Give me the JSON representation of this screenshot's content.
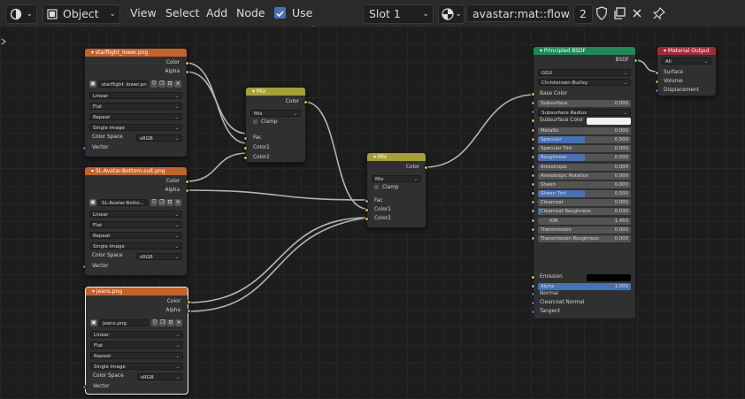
{
  "header": {
    "editor_icon": "node-editor-icon",
    "object_mode": "Object",
    "menus": [
      "View",
      "Select",
      "Add",
      "Node"
    ],
    "use_nodes_label": "Use Nodes",
    "use_nodes_checked": true,
    "slot": "Slot 1",
    "material_name": "avastar:mat::flower..",
    "user_count": "2"
  },
  "nodes": {
    "tex1": {
      "title": "starflight_lower.png",
      "out_color": "Color",
      "out_alpha": "Alpha",
      "image": "starflight_lower.png",
      "interpolation": "Linear",
      "projection": "Flat",
      "extension": "Repeat",
      "source": "Single Image",
      "colorspace_label": "Color Space",
      "colorspace": "sRGB",
      "vector": "Vector"
    },
    "tex2": {
      "title": "SL-Avatar-Bottom-suit.png",
      "out_color": "Color",
      "out_alpha": "Alpha",
      "image": "SL-Avatar-Botto...",
      "interpolation": "Linear",
      "projection": "Flat",
      "extension": "Repeat",
      "source": "Single Image",
      "colorspace_label": "Color Space",
      "colorspace": "sRGB",
      "vector": "Vector"
    },
    "tex3": {
      "title": "jeans.png",
      "out_color": "Color",
      "out_alpha": "Alpha",
      "image": "jeans.png",
      "interpolation": "Linear",
      "projection": "Flat",
      "extension": "Repeat",
      "source": "Single Image",
      "colorspace_label": "Color Space",
      "colorspace": "sRGB",
      "vector": "Vector"
    },
    "mix1": {
      "title": "Mix",
      "out_color": "Color",
      "blend": "Mix",
      "clamp": "Clamp",
      "fac": "Fac",
      "color1": "Color1",
      "color2": "Color2"
    },
    "mix2": {
      "title": "Mix",
      "out_color": "Color",
      "blend": "Mix",
      "clamp": "Clamp",
      "fac": "Fac",
      "color1": "Color1",
      "color2": "Color2"
    },
    "bsdf": {
      "title": "Principled BSDF",
      "out": "BSDF",
      "distribution": "GGX",
      "subsurface_method": "Christensen-Burley",
      "base_color": "Base Color",
      "subsurface_radius": "Subsurface Radius",
      "subsurface_color": "Subsurface Color",
      "fields": [
        {
          "label": "Subsurface",
          "value": "0.000",
          "fill": 0
        },
        {
          "label": "Metallic",
          "value": "0.000",
          "fill": 0
        },
        {
          "label": "Specular",
          "value": "0.500",
          "fill": 0.5
        },
        {
          "label": "Specular Tint",
          "value": "0.000",
          "fill": 0
        },
        {
          "label": "Roughness",
          "value": "0.500",
          "fill": 0.5
        },
        {
          "label": "Anisotropic",
          "value": "0.000",
          "fill": 0
        },
        {
          "label": "Anisotropic Rotation",
          "value": "0.000",
          "fill": 0
        },
        {
          "label": "Sheen",
          "value": "0.000",
          "fill": 0
        },
        {
          "label": "Sheen Tint",
          "value": "0.500",
          "fill": 0.5
        },
        {
          "label": "Clearcoat",
          "value": "0.000",
          "fill": 0
        },
        {
          "label": "Clearcoat Roughness",
          "value": "0.030",
          "fill": 0.03
        },
        {
          "label": "IOR",
          "value": "1.450",
          "fill": 0
        },
        {
          "label": "Transmission",
          "value": "0.000",
          "fill": 0
        },
        {
          "label": "Transmission Roughness",
          "value": "0.000",
          "fill": 0
        }
      ],
      "emission": "Emission",
      "alpha": "Alpha",
      "alpha_value": "1.000",
      "normal": "Normal",
      "clearcoat_normal": "Clearcoat Normal",
      "tangent": "Tangent"
    },
    "output": {
      "title": "Material Output",
      "target": "All",
      "surface": "Surface",
      "volume": "Volume",
      "displacement": "Displacement"
    }
  },
  "colors": {
    "texture_header": "#c2622d",
    "mix_header": "#a6a037",
    "bsdf_header": "#1f8955",
    "output_header": "#a32a39",
    "accent": "#4772b3"
  }
}
